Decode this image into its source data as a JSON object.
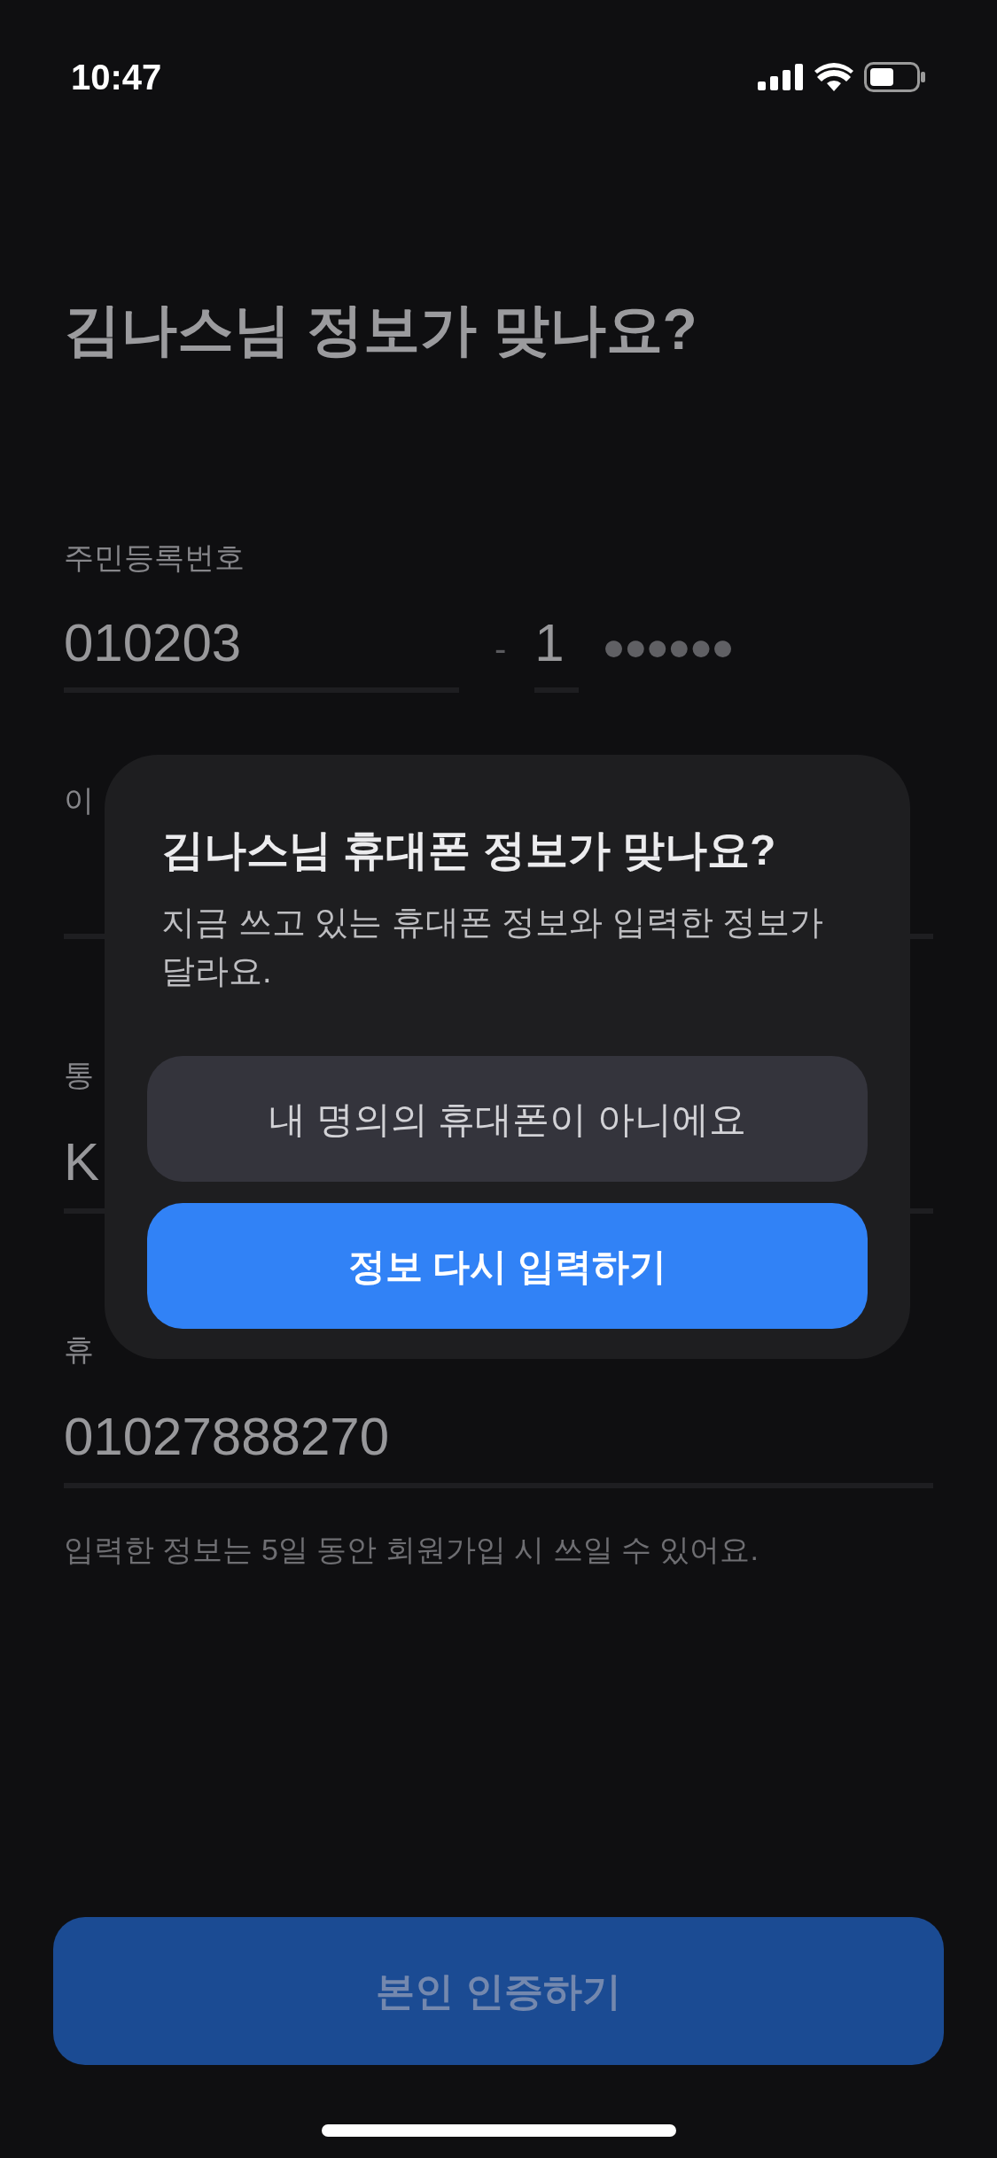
{
  "status_bar": {
    "time": "10:47"
  },
  "title": "김나스님 정보가 맞나요?",
  "id_number": {
    "label": "주민등록번호",
    "front": "010203",
    "separator": "-",
    "back_first": "1",
    "masked": "●●●●●●"
  },
  "fields": [
    {
      "label": "이"
    },
    {
      "label": "통",
      "value": "K"
    },
    {
      "label": "휴",
      "value": "01027888270"
    }
  ],
  "note": "입력한 정보는 5일 동안 회원가입 시 쓰일 수 있어요.",
  "dialog": {
    "title": "김나스님 휴대폰 정보가 맞나요?",
    "message": "지금 쓰고 있는 휴대폰 정보와 입력한 정보가 달라요.",
    "buttons": [
      {
        "label": "내 명의의 휴대폰이 아니에요",
        "kind": "secondary"
      },
      {
        "label": "정보 다시 입력하기",
        "kind": "primary"
      }
    ]
  },
  "cta": "본인 인증하기"
}
